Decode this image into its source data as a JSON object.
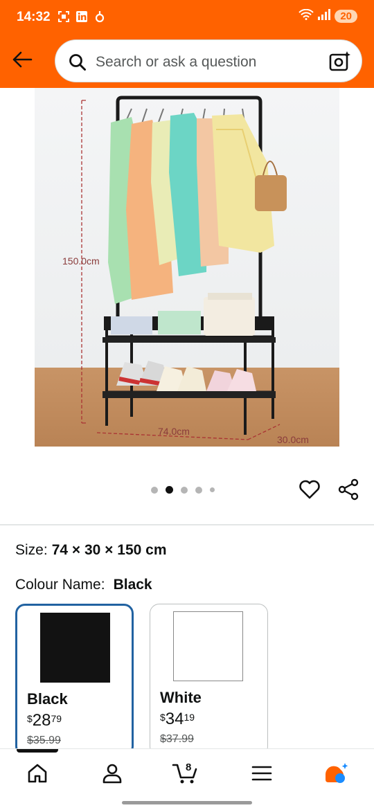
{
  "status": {
    "time": "14:32",
    "battery": "20"
  },
  "search": {
    "placeholder": "Search or ask a question"
  },
  "product_image": {
    "dim_height": "150.0cm",
    "dim_width": "74.0cm",
    "dim_depth": "30.0cm"
  },
  "carousel": {
    "count": 5,
    "active_index": 1
  },
  "size": {
    "label": "Size:",
    "value": "74 × 30 × 150 cm"
  },
  "colour": {
    "label": "Colour Name:",
    "value": "Black"
  },
  "swatches": [
    {
      "name": "Black",
      "currency": "$",
      "dollars": "28",
      "cents": "79",
      "old_price": "$35.99",
      "color": "#121212"
    },
    {
      "name": "White",
      "currency": "$",
      "dollars": "34",
      "cents": "19",
      "old_price": "$37.99",
      "color": "#ffffff"
    }
  ],
  "cart": {
    "count": "8"
  },
  "colors": {
    "header": "#ff6200",
    "selected_border": "#2162a1"
  }
}
